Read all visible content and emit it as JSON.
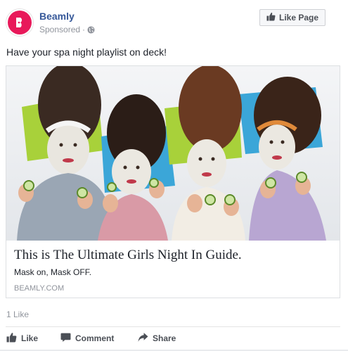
{
  "header": {
    "page_name": "Beamly",
    "sponsored": "Sponsored",
    "separator": "·",
    "like_page_label": "Like Page"
  },
  "post": {
    "text": "Have your spa night playlist on deck!"
  },
  "link_card": {
    "title": "This is The Ultimate Girls Night In Guide.",
    "description": "Mask on, Mask OFF.",
    "domain": "BEAMLY.COM"
  },
  "engagement": {
    "likes": "1 Like"
  },
  "actions": {
    "like": "Like",
    "comment": "Comment",
    "share": "Share"
  },
  "colors": {
    "brand_link": "#365899",
    "beamly_pink": "#e8195a",
    "meta_gray": "#90949c",
    "action_gray": "#4b4f56"
  },
  "icons": [
    "beamly-logo-icon",
    "globe-icon",
    "thumbs-up-icon",
    "comment-icon",
    "share-icon"
  ]
}
